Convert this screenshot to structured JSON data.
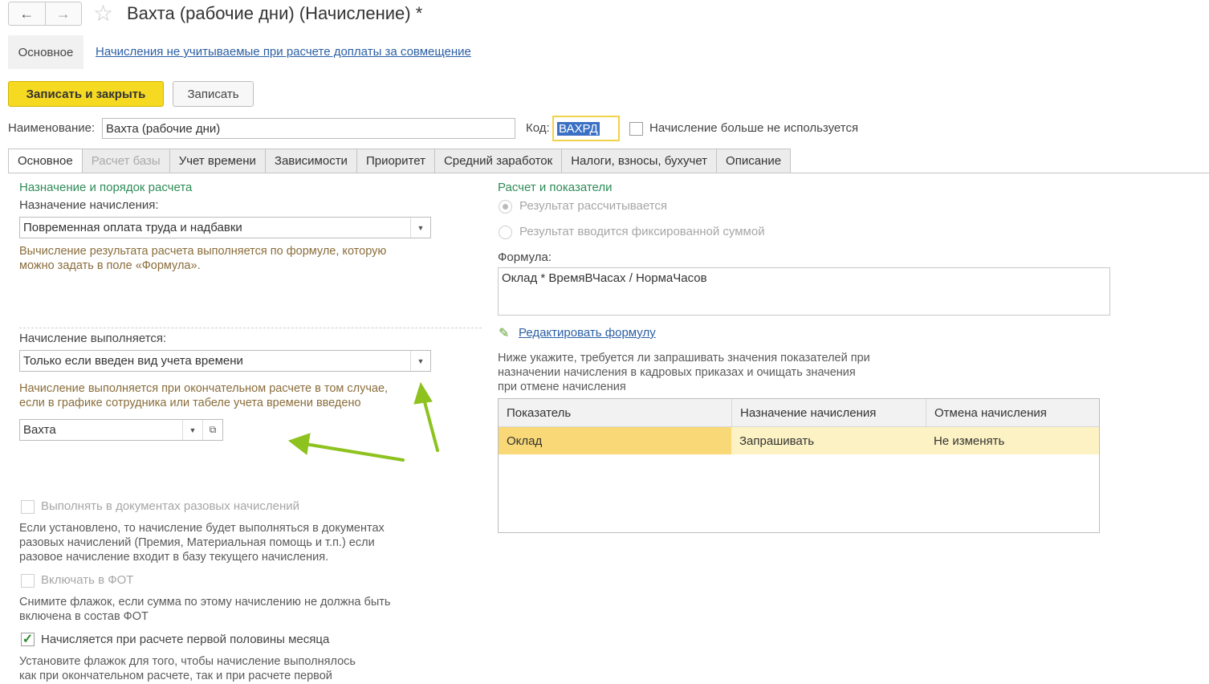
{
  "header": {
    "title": "Вахта (рабочие дни) (Начисление) *",
    "back_icon": "←",
    "forward_icon": "→",
    "star_icon": "☆"
  },
  "sections": {
    "main": "Основное",
    "link": "Начисления не учитываемые при расчете доплаты за совмещение"
  },
  "toolbar": {
    "save_close": "Записать и закрыть",
    "save": "Записать"
  },
  "name": {
    "label": "Наименование:",
    "value": "Вахта (рабочие дни)"
  },
  "code": {
    "label": "Код:",
    "value": "ВАХРД"
  },
  "unused": {
    "label": "Начисление больше не используется",
    "checked": false
  },
  "tabs": [
    {
      "label": "Основное"
    },
    {
      "label": "Расчет базы"
    },
    {
      "label": "Учет времени"
    },
    {
      "label": "Зависимости"
    },
    {
      "label": "Приоритет"
    },
    {
      "label": "Средний заработок"
    },
    {
      "label": "Налоги, взносы, бухучет"
    },
    {
      "label": "Описание"
    }
  ],
  "left": {
    "section_title": "Назначение и порядок расчета",
    "purpose_label": "Назначение начисления:",
    "purpose_value": "Повременная оплата труда и надбавки",
    "purpose_hint_1": "Вычисление результата расчета выполняется по формуле, которую",
    "purpose_hint_2": "можно задать в поле «Формула».",
    "exec_label": "Начисление выполняется:",
    "exec_value": "Только если введен вид учета времени",
    "exec_hint_1": "Начисление выполняется при окончательном расчете в том случае,",
    "exec_hint_2": "если в графике сотрудника или табеле учета времени введено",
    "time_type_value": "Вахта",
    "onetime_label": "Выполнять в документах разовых начислений",
    "onetime_hint_1": "Если установлено, то начисление будет выполняться в документах",
    "onetime_hint_2": "разовых начислений (Премия, Материальная помощь и т.п.) если",
    "onetime_hint_3": "разовое начисление входит в базу текущего начисления.",
    "fot_label": "Включать в ФОТ",
    "fot_hint_1": "Снимите флажок, если сумма по этому начислению не должна быть",
    "fot_hint_2": "включена в состав ФОТ",
    "half_label": "Начисляется при расчете первой половины месяца",
    "half_hint_1": "Установите флажок для того, чтобы начисление выполнялось",
    "half_hint_2": "как при окончательном расчете, так и при расчете первой"
  },
  "right": {
    "section_title": "Расчет и показатели",
    "radio_calc": "Результат рассчитывается",
    "radio_fixed": "Результат вводится фиксированной суммой",
    "formula_label": "Формула:",
    "formula_value": "Оклад * ВремяВЧасах / НормаЧасов",
    "edit_link": "Редактировать формулу",
    "note_1": "Ниже укажите, требуется ли запрашивать значения показателей при",
    "note_2": "назначении начисления в кадровых приказах и очищать значения",
    "note_3": "при отмене начисления",
    "table": {
      "columns": [
        "Показатель",
        "Назначение начисления",
        "Отмена начисления"
      ],
      "rows": [
        [
          "Оклад",
          "Запрашивать",
          "Не изменять"
        ]
      ]
    }
  },
  "colors": {
    "accent_yellow": "#f6d921",
    "section_green": "#2e8b57",
    "link_blue": "#2b5fa4",
    "arrow_green": "#8dc21f"
  }
}
